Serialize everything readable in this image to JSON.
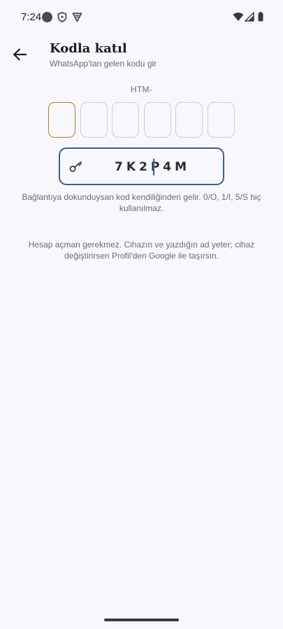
{
  "status_bar": {
    "time": "7:24",
    "icons": [
      "record-dot-icon",
      "shield-icon",
      "vpn-icon",
      "wifi-icon",
      "signal-icon",
      "battery-icon"
    ]
  },
  "header": {
    "back_icon": "arrow-back-icon",
    "title": "Kodla katıl",
    "subtitle": "WhatsApp'tan gelen kodu gir"
  },
  "code_entry": {
    "prefix": "HTM-",
    "boxes": [
      "",
      "",
      "",
      "",
      "",
      ""
    ],
    "active_box": 0,
    "active_color": "#a8852b"
  },
  "key_field": {
    "icon": "key-icon",
    "value": "7K2P4M",
    "border_color": "#3b5f89"
  },
  "hint": "Bağlantıya dokunduysan kod kendiliğinden gelir. 0/O, 1/I, 5/S hiç kullanılmaz.",
  "note": "Hesap açman gerekmez. Cihazın ve yazdığın ad yeter; cihaz değiştirirsen Profil'den Google ile taşırsın."
}
